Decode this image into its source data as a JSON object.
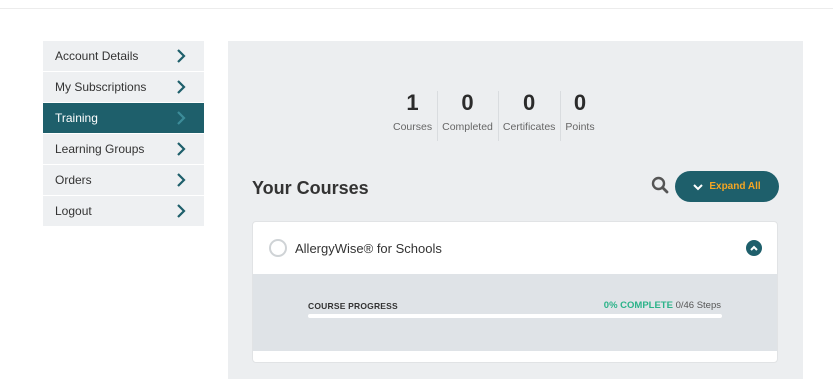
{
  "sidebar": {
    "items": [
      {
        "label": "Account Details"
      },
      {
        "label": "My Subscriptions"
      },
      {
        "label": "Training"
      },
      {
        "label": "Learning Groups"
      },
      {
        "label": "Orders"
      },
      {
        "label": "Logout"
      }
    ],
    "active_index": 2
  },
  "stats": [
    {
      "value": "1",
      "label": "Courses"
    },
    {
      "value": "0",
      "label": "Completed"
    },
    {
      "value": "0",
      "label": "Certificates"
    },
    {
      "value": "0",
      "label": "Points"
    }
  ],
  "courses_section": {
    "title": "Your Courses",
    "expand_all_label": "Expand All"
  },
  "course": {
    "title": "AllergyWise® for Schools",
    "progress_label": "COURSE PROGRESS",
    "percent_text": "0% COMPLETE",
    "steps_text": "0/46 Steps",
    "progress_fraction": 0
  },
  "colors": {
    "brand": "#1e5f6b",
    "accent": "#f5a623",
    "success": "#2bb389"
  },
  "icons": [
    "chevron-right-icon",
    "search-icon",
    "chevron-down-icon",
    "chevron-up-icon"
  ]
}
